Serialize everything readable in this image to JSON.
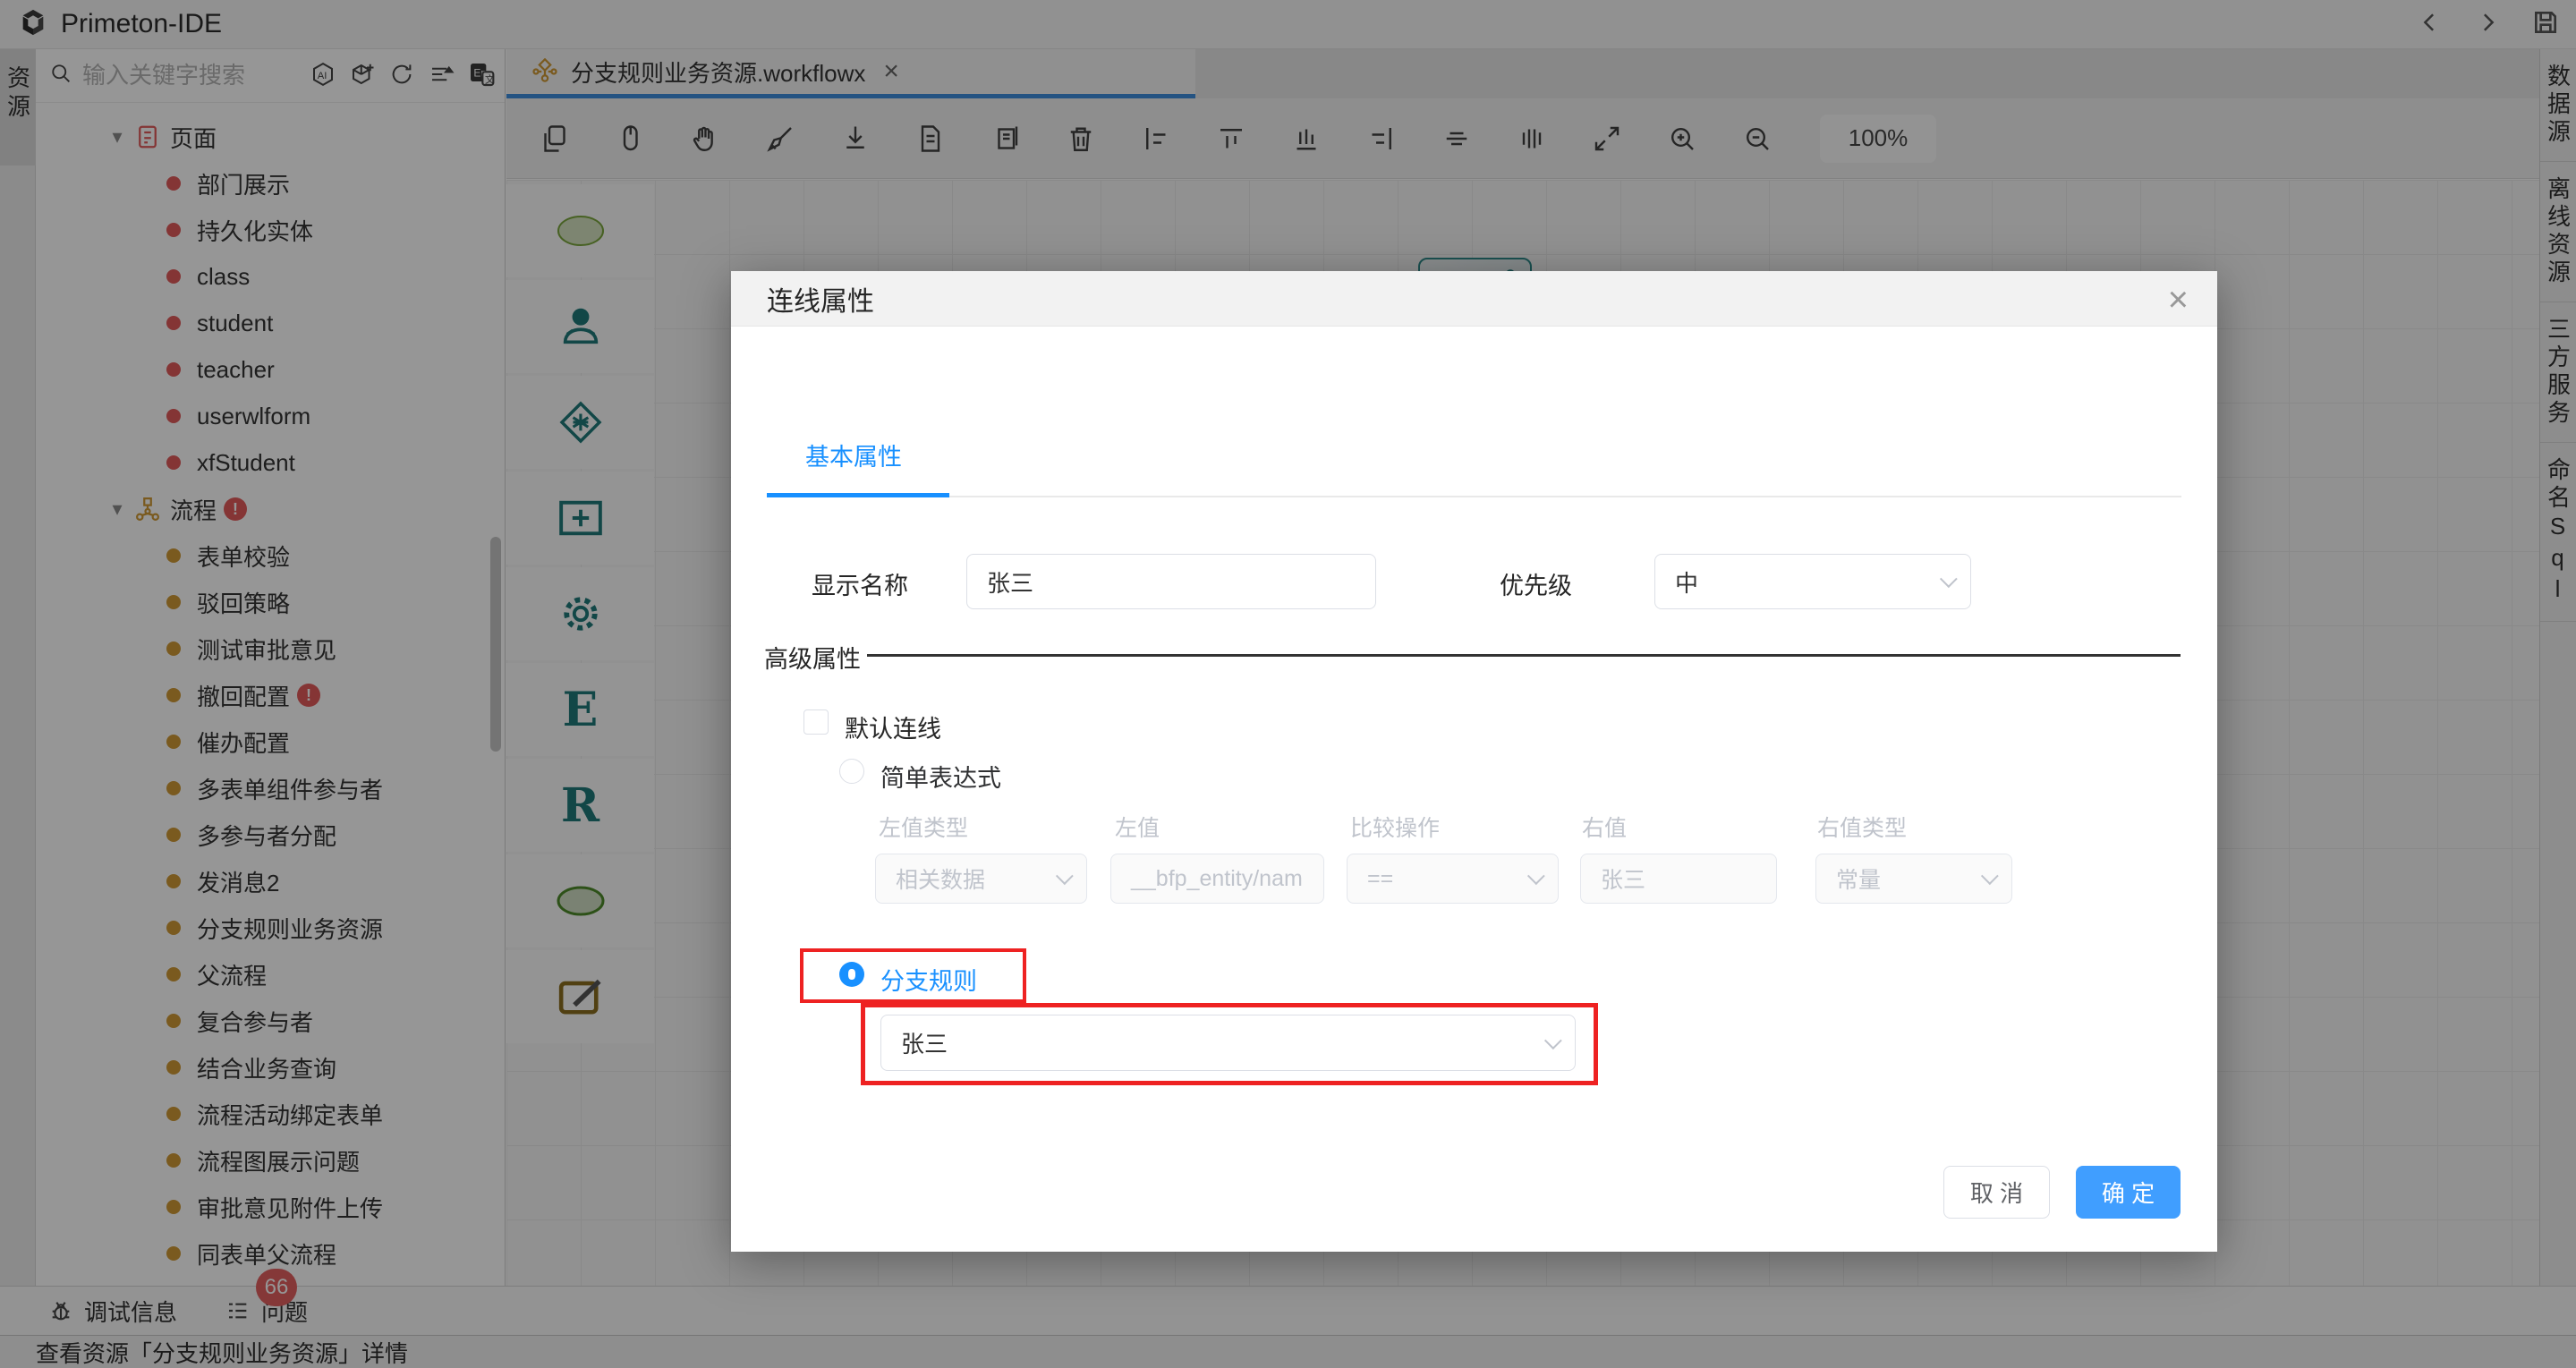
{
  "app": {
    "title": "Primeton-IDE"
  },
  "header": {
    "icons": [
      "chevron-left-icon",
      "chevron-right-icon",
      "save-icon"
    ]
  },
  "left_rail": {
    "active_tab": "资源"
  },
  "sidebar": {
    "search": {
      "placeholder": "输入关键字搜索",
      "icons": [
        "ai-icon",
        "new-resource-icon",
        "refresh-icon",
        "sort-list-icon",
        "translate-icon"
      ]
    },
    "tree": {
      "groups": [
        {
          "label": "页面",
          "icon": "page-icon",
          "items": [
            {
              "label": "部门展示"
            },
            {
              "label": "持久化实体"
            },
            {
              "label": "class"
            },
            {
              "label": "student"
            },
            {
              "label": "teacher"
            },
            {
              "label": "userwlform"
            },
            {
              "label": "xfStudent"
            }
          ]
        },
        {
          "label": "流程",
          "icon": "flow-icon",
          "error": true,
          "items": [
            {
              "label": "表单校验"
            },
            {
              "label": "驳回策略"
            },
            {
              "label": "测试审批意见"
            },
            {
              "label": "撤回配置",
              "error": true
            },
            {
              "label": "催办配置"
            },
            {
              "label": "多表单组件参与者"
            },
            {
              "label": "多参与者分配"
            },
            {
              "label": "发消息2"
            },
            {
              "label": "分支规则业务资源"
            },
            {
              "label": "父流程"
            },
            {
              "label": "复合参与者"
            },
            {
              "label": "结合业务查询"
            },
            {
              "label": "流程活动绑定表单"
            },
            {
              "label": "流程图展示问题"
            },
            {
              "label": "审批意见附件上传"
            },
            {
              "label": "同表单父流程"
            }
          ]
        }
      ]
    }
  },
  "editor": {
    "tab": {
      "label": "分支规则业务资源.workflowx",
      "close": "×",
      "icon": "workflow-icon"
    },
    "toolbar": {
      "icons": [
        "copy-icon",
        "mouse-pointer-icon",
        "hand-pan-icon",
        "clear-canvas-icon",
        "download-icon",
        "new-document-icon",
        "copy-document-icon",
        "delete-icon",
        "align-left-icon",
        "align-top-icon",
        "align-bottom-icon",
        "align-right-icon",
        "center-horizontal-icon",
        "distribute-vertical-icon",
        "fit-screen-icon",
        "zoom-in-icon",
        "zoom-out-icon"
      ],
      "zoom_level": "100%"
    },
    "palette": {
      "items": [
        "start-node-icon",
        "manual-activity-icon",
        "decision-node-icon",
        "subprocess-node-icon",
        "auto-activity-icon",
        "letter-e-node-icon",
        "letter-r-node-icon",
        "end-node-icon",
        "note-node-icon"
      ]
    },
    "canvas": {
      "node": "manual-activity-node"
    }
  },
  "right_rail": {
    "tabs": [
      {
        "label": "数据源"
      },
      {
        "label": "离线资源"
      },
      {
        "label": "三方服务"
      },
      {
        "label": "命名Sql"
      }
    ]
  },
  "debug_bar": {
    "debug_label": "调试信息",
    "problems_label": "问题",
    "problems_count": "66"
  },
  "status_bar": {
    "text": "查看资源「分支规则业务资源」详情"
  },
  "modal": {
    "title": "连线属性",
    "close": "×",
    "tab": "基本属性",
    "form": {
      "display_name": {
        "label": "显示名称",
        "value": "张三"
      },
      "priority": {
        "label": "优先级",
        "value": "中"
      },
      "advanced_label": "高级属性",
      "default_line_label": "默认连线",
      "simple_expr_label": "简单表达式",
      "expr_fields": [
        {
          "label": "左值类型",
          "value": "相关数据",
          "type": "select"
        },
        {
          "label": "左值",
          "value": "__bfp_entity/nam",
          "type": "input"
        },
        {
          "label": "比较操作",
          "value": "==",
          "type": "select"
        },
        {
          "label": "右值",
          "value": "张三",
          "type": "input"
        },
        {
          "label": "右值类型",
          "value": "常量",
          "type": "select"
        }
      ],
      "branch_rule": {
        "label": "分支规则",
        "value": "张三"
      }
    },
    "footer": {
      "cancel": "取 消",
      "ok": "确 定"
    },
    "colors": {
      "accent_blue": "#1890ff",
      "button_blue": "#409eff",
      "annotation_red": "#ee2222"
    }
  }
}
